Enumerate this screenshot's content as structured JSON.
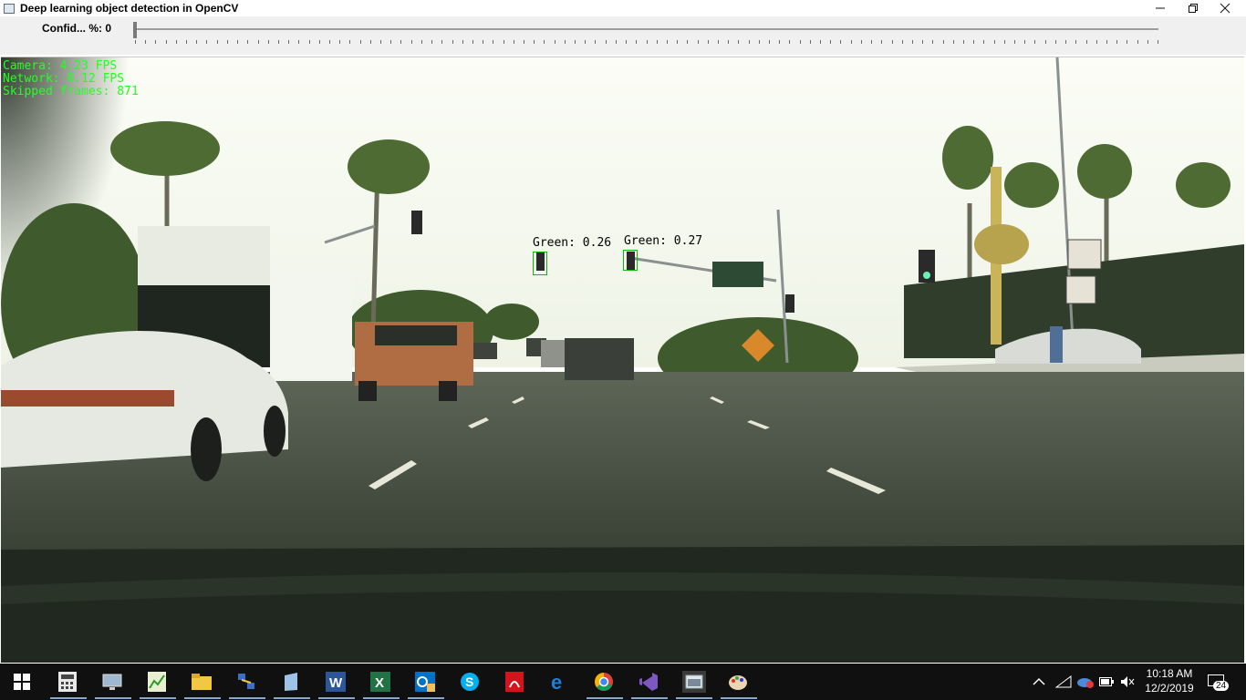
{
  "window": {
    "title": "Deep learning object detection in OpenCV",
    "controls": [
      "minimize-icon",
      "restore-icon",
      "close-icon"
    ]
  },
  "trackbar": {
    "label": "Confid... %: 0",
    "value_percent": 0
  },
  "overlay": {
    "camera_fps": "Camera: 4.23 FPS",
    "network_fps": "Network: 0.12 FPS",
    "skipped_frames": "Skipped frames: 871"
  },
  "detections": [
    {
      "label": "Green: 0.26"
    },
    {
      "label": "Green: 0.27"
    }
  ],
  "taskbar": {
    "start_icon": "windows-start-icon",
    "pinned_apps": [
      "calculator-icon",
      "remote-desktop-icon",
      "task-manager-icon",
      "file-explorer-icon",
      "network-icon",
      "notepad-icon",
      "word-icon",
      "excel-icon",
      "outlook-icon",
      "skype-icon",
      "acrobat-icon",
      "edge-icon",
      "chrome-icon",
      "visual-studio-icon",
      "opencv-window-icon",
      "paint-icon"
    ],
    "clock_time": "10:18 AM",
    "clock_date": "12/2/2019",
    "notification_count": "24",
    "accent": "#8aa9c9"
  }
}
